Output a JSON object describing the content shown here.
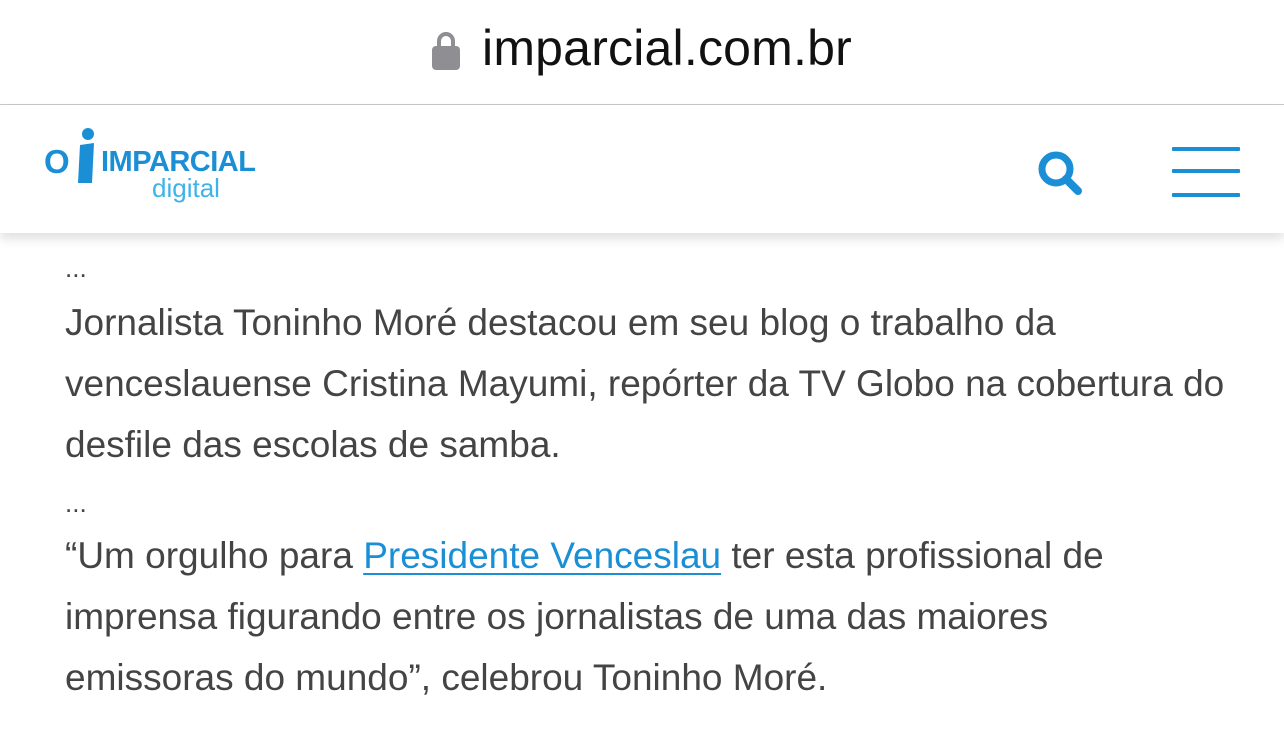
{
  "browser": {
    "url": "imparcial.com.br",
    "lock_icon": "lock-icon"
  },
  "site": {
    "logo": {
      "prefix": "O",
      "name": "IMPARCIAL",
      "sub": "digital"
    },
    "search_icon": "search-icon",
    "menu_icon": "hamburger-menu-icon",
    "colors": {
      "accent": "#1a8fd6",
      "accent_light": "#3eb3e8",
      "text": "#444444"
    }
  },
  "article": {
    "ellipsis_1": "...",
    "paragraph_1": "Jornalista Toninho Moré destacou em seu blog o trabalho da venceslauense Cristina Mayumi, repórter da TV Globo na cobertura do desfile das escolas de samba.",
    "ellipsis_2": "...",
    "quote_before_link": "“Um orgulho para ",
    "quote_link": "Presidente Venceslau",
    "quote_after_link": " ter esta profissional de imprensa figurando entre os jornalistas de uma das maiores emissoras do mundo”, celebrou Toninho Moré."
  }
}
